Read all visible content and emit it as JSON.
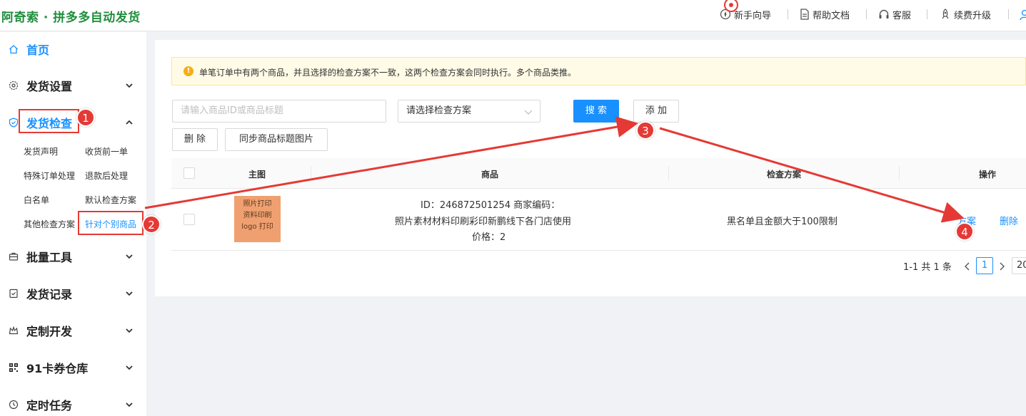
{
  "header": {
    "brand": "阿奇索 · 拼多多自动发货",
    "nav": [
      "新手向导",
      "帮助文档",
      "客服",
      "续费升级"
    ]
  },
  "sidebar": {
    "items": [
      {
        "label": "首页",
        "icon": "home-icon"
      },
      {
        "label": "发货设置",
        "icon": "gear-icon"
      },
      {
        "label": "发货检查",
        "icon": "shield-check-icon"
      },
      {
        "label": "批量工具",
        "icon": "toolbox-icon"
      },
      {
        "label": "发货记录",
        "icon": "record-icon"
      },
      {
        "label": "定制开发",
        "icon": "crown-icon"
      },
      {
        "label": "91卡券仓库",
        "icon": "qrcode-icon"
      },
      {
        "label": "定时任务",
        "icon": "clock-icon"
      }
    ],
    "submenu": [
      "发货声明",
      "收货前一单",
      "特殊订单处理",
      "退款后处理",
      "白名单",
      "默认检查方案",
      "其他检查方案",
      "针对个别商品"
    ]
  },
  "alert": {
    "text": "单笔订单中有两个商品，并且选择的检查方案不一致，这两个检查方案会同时执行。多个商品类推。"
  },
  "search": {
    "placeholder": "请输入商品ID或商品标题",
    "scheme_select": "请选择检查方案",
    "search_label": "搜 索",
    "add_label": "添 加",
    "delete_label": "删 除",
    "sync_label": "同步商品标题图片"
  },
  "table": {
    "columns": [
      "主图",
      "商品",
      "检查方案",
      "操作"
    ],
    "rows": [
      {
        "thumb_lines": [
          "照片打印",
          "资料印刷",
          "logo 打印"
        ],
        "id_line": "ID：246872501254 商家编码：",
        "title": "照片素材材料印刷彩印新鹏线下各门店使用",
        "price": "价格：2",
        "scheme": "黑名单且金额大于100限制",
        "actions": [
          "方案",
          "删除"
        ]
      }
    ]
  },
  "pagination": {
    "summary": "1-1 共 1 条",
    "current": "1",
    "page_size": "20"
  },
  "annotations": [
    "1",
    "2",
    "3",
    "4"
  ],
  "colors": {
    "brand": "#1f8e3d",
    "primary": "#1890ff",
    "annotation": "#e53935",
    "alert_bg": "#fffbe6"
  }
}
